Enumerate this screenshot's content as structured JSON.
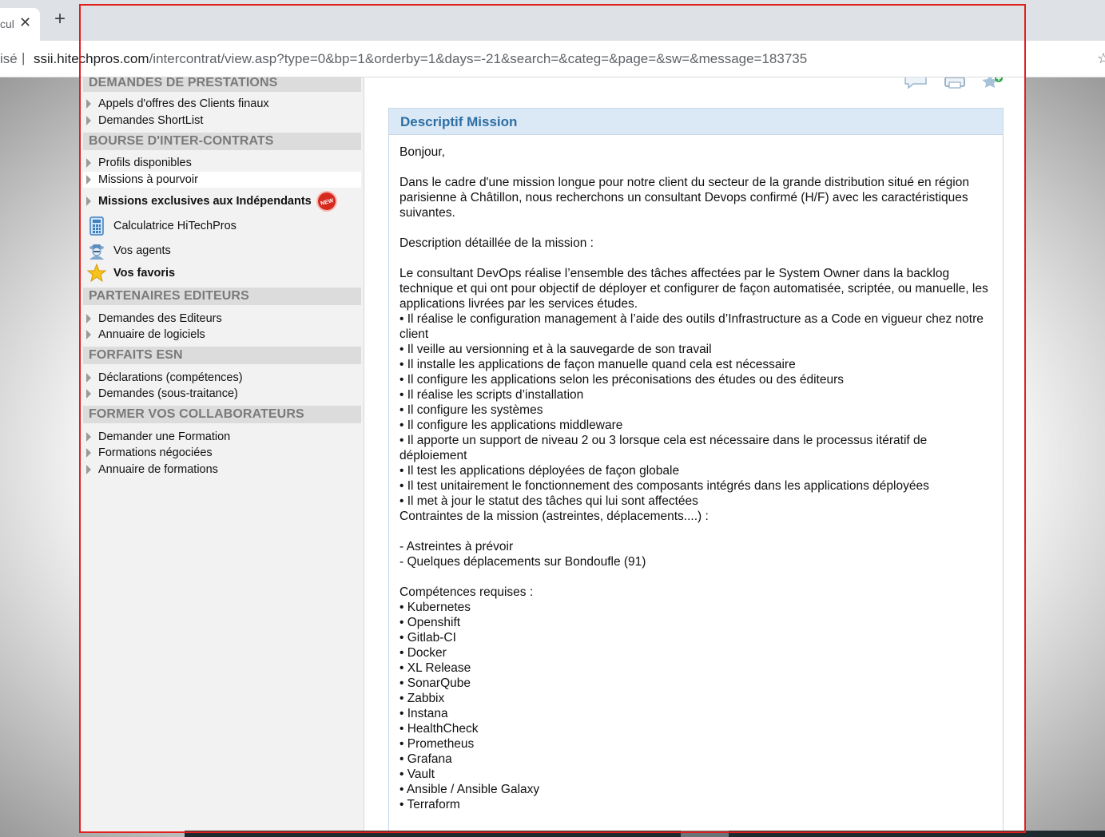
{
  "browser": {
    "tab_title": "cul",
    "tab_close": "✕",
    "new_tab": "+",
    "addr_prefix": "isé",
    "addr_separator": "|",
    "url_host": "ssii.hitechpros.com",
    "url_path": "/intercontrat/view.asp?type=0&bp=1&orderby=1&days=-21&search=&categ=&page=&sw=&message=183735"
  },
  "sidebar": {
    "sections": [
      {
        "title": "DEMANDES DE PRESTATIONS",
        "items": [
          "Appels d'offres des Clients finaux",
          "Demandes ShortList"
        ]
      },
      {
        "title": "BOURSE D'INTER-CONTRATS",
        "items": [
          "Profils disponibles",
          "Missions à pourvoir",
          "Missions exclusives aux Indépendants"
        ]
      },
      {
        "title": "PARTENAIRES EDITEURS",
        "items": [
          "Demandes des Editeurs",
          "Annuaire de logiciels"
        ]
      },
      {
        "title": "FORFAITS ESN",
        "items": [
          "Déclarations (compétences)",
          "Demandes (sous-traitance)"
        ]
      },
      {
        "title": "FORMER VOS COLLABORATEURS",
        "items": [
          "Demander une Formation",
          "Formations négociées",
          "Annuaire de formations"
        ]
      }
    ],
    "new_badge": "NEW",
    "tools": [
      "Calculatrice HiTechPros",
      "Vos agents",
      "Vos favoris"
    ]
  },
  "mission": {
    "title": "Descriptif Mission",
    "lines": [
      "Bonjour,",
      "",
      "Dans le cadre d'une mission longue pour notre client du secteur de la grande distribution situé en région parisienne à Châtillon, nous recherchons un consultant Devops confirmé (H/F) avec les caractéristiques suivantes.",
      "",
      "Description détaillée de la mission :",
      "",
      "Le consultant DevOps réalise l’ensemble des tâches affectées par le System Owner dans la backlog technique et qui ont pour objectif de déployer et configurer de façon automatisée, scriptée, ou manuelle, les applications livrées par les services études.",
      "• Il réalise le configuration management à l’aide des outils d’Infrastructure as a Code en vigueur chez notre client",
      "• Il veille au versionning et à la sauvegarde de son travail",
      "• Il installe les applications de façon manuelle quand cela est nécessaire",
      "• Il configure les applications selon les préconisations des études ou des éditeurs",
      "• Il réalise les scripts d’installation",
      "• Il configure les systèmes",
      "• Il configure les applications middleware",
      "• Il apporte un support de niveau 2 ou 3 lorsque cela est nécessaire dans le processus itératif de déploiement",
      "• Il test les applications déployées de façon globale",
      "• Il test unitairement le fonctionnement des composants intégrés dans les applications déployées",
      "• Il met à jour le statut des tâches qui lui sont affectées",
      "Contraintes de la mission (astreintes, déplacements....) :",
      "",
      "- Astreintes à prévoir",
      "- Quelques déplacements sur Bondoufle (91)",
      "",
      "Compétences requises :",
      "• Kubernetes",
      "• Openshift",
      "• Gitlab-CI",
      "• Docker",
      "• XL Release",
      "• SonarQube",
      "• Zabbix",
      "• Instana",
      "• HealthCheck",
      "• Prometheus",
      "• Grafana",
      "• Vault",
      "• Ansible / Ansible Galaxy",
      "• Terraform"
    ]
  }
}
